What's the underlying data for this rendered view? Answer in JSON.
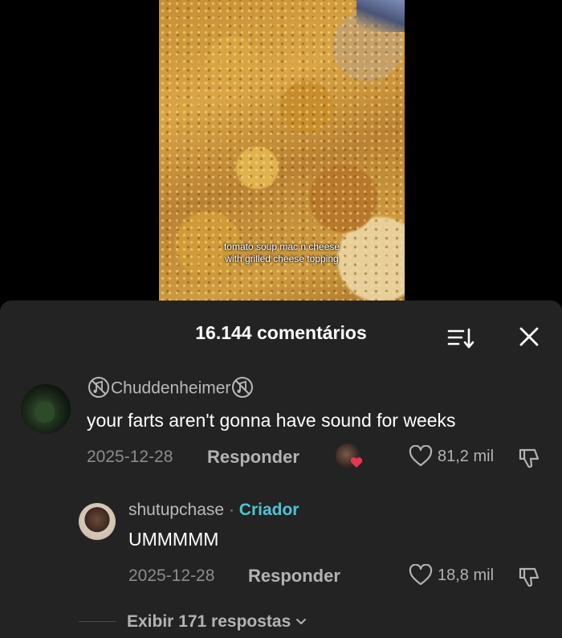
{
  "video": {
    "caption_line1": "tomato soup mac n cheese",
    "caption_line2": "with grilled cheese topping"
  },
  "comments_sheet": {
    "title": "16.144 comentários",
    "sort_icon": "sort-icon",
    "close_icon": "close-icon"
  },
  "comments": [
    {
      "username": "Chuddenheimer",
      "username_icons": [
        "no-sound-icon",
        "no-sound-icon"
      ],
      "text": "your farts aren't gonna have sound for weeks",
      "date": "2025-12-28",
      "reply_label": "Responder",
      "likes": "81,2 mil",
      "creator_liked": true
    },
    {
      "username": "shutupchase",
      "separator": "·",
      "badge": "Criador",
      "text": "UMMMMM",
      "date": "2025-12-28",
      "reply_label": "Responder",
      "likes": "18,8 mil"
    }
  ],
  "view_replies": {
    "label": "Exibir 171 respostas",
    "icon": "chevron-down-icon"
  },
  "colors": {
    "sheet_background": "#232323",
    "creator_badge": "#4fc3d6",
    "creator_liked_heart": "#e8364f"
  }
}
